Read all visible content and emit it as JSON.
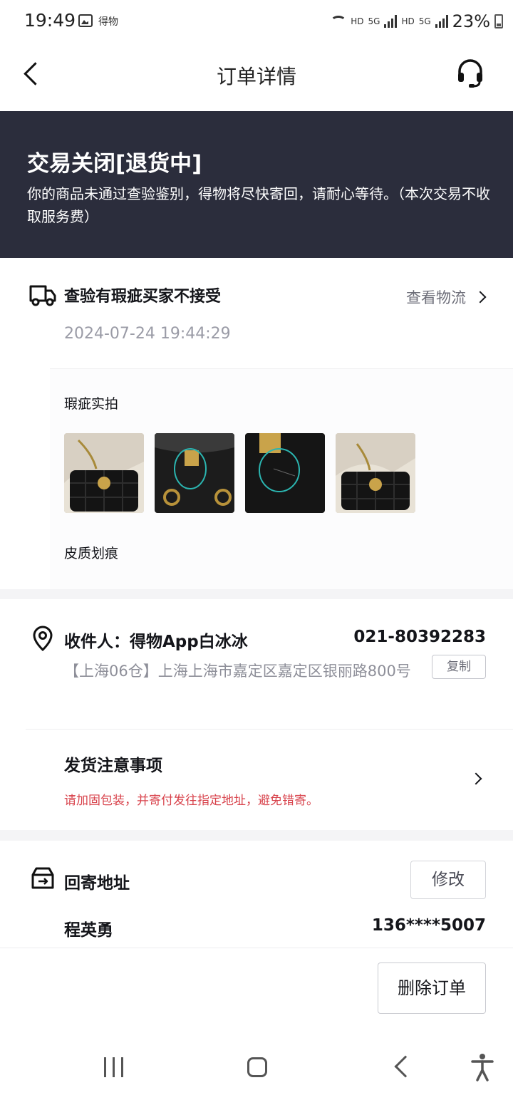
{
  "status_bar": {
    "time": "19:49",
    "app_label": "得物",
    "network_1": "HD",
    "network_2": "5G",
    "network_3": "HD",
    "network_4": "5G",
    "battery": "23%"
  },
  "nav": {
    "title": "订单详情"
  },
  "banner": {
    "status": "交易关闭[退货中]",
    "description": "你的商品未通过查验鉴别，得物将尽快寄回，请耐心等待。（本次交易不收取服务费）"
  },
  "logistics": {
    "title": "查验有瑕疵买家不接受",
    "link": "查看物流",
    "time": "2024-07-24 19:44:29",
    "flaw_title": "瑕疵实拍",
    "flaw_note": "皮质划痕"
  },
  "receiver": {
    "name": "收件人：得物App白冰冰",
    "phone": "021-80392283",
    "address": "【上海06仓】上海上海市嘉定区嘉定区银丽路800号",
    "copy": "复制"
  },
  "shipping_note": {
    "title": "发货注意事项",
    "desc": "请加固包装，并寄付发往指定地址，避免错寄。"
  },
  "return_address": {
    "title": "回寄地址",
    "modify": "修改",
    "name": "程英勇",
    "phone": "136****5007"
  },
  "actions": {
    "delete": "删除订单"
  },
  "colors": {
    "banner_bg": "#2b2d3c",
    "warning": "#d8434c",
    "muted": "#9a9ba6"
  }
}
